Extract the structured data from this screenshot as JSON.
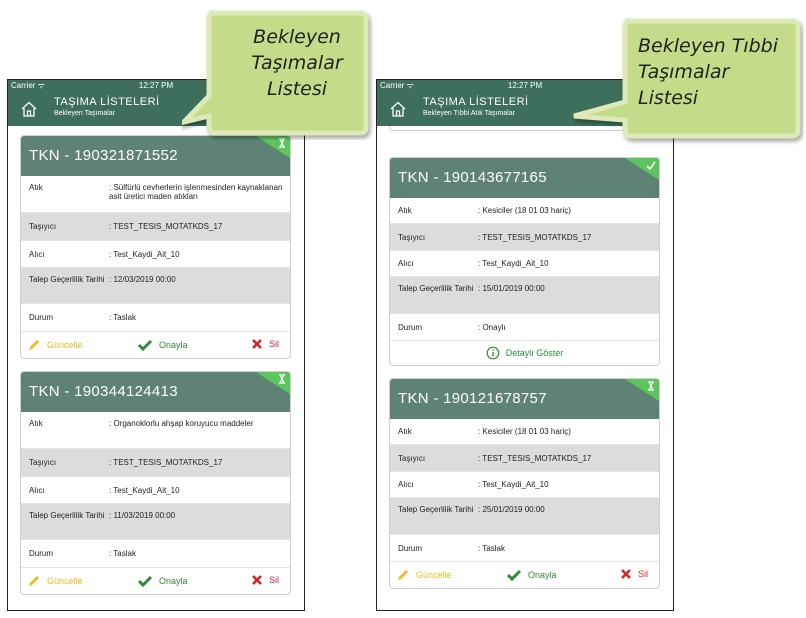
{
  "left_screen": {
    "status": {
      "carrier": "Carrier ᯤ",
      "time": "12:27 PM"
    },
    "header": {
      "title": "TAŞIMA LİSTELERİ",
      "subtitle": "Bekleyen Taşımalar"
    },
    "cards": [
      {
        "tkn": "TKN - 190321871552",
        "rows": [
          {
            "key": "Atık",
            "value": ": Sülfürlü cevherlerin işlenmesinden kaynaklanan asit üretici maden atıkları"
          },
          {
            "key": "Taşıyıcı",
            "value": ": TEST_TESIS_MOTATKDS_17"
          },
          {
            "key": "Alıcı",
            "value": ": Test_Kaydi_Ait_10"
          },
          {
            "key": "Talep Geçerlilik Tarihi",
            "value": ": 12/03/2019  00:00"
          },
          {
            "key": "Durum",
            "value": ": Taslak"
          }
        ],
        "actions": {
          "edit": "Güncelle",
          "approve": "Onayla",
          "delete": "Sil"
        }
      },
      {
        "tkn": "TKN - 190344124413",
        "rows": [
          {
            "key": "Atık",
            "value": ": Organoklorlu ahşap koruyucu maddeler"
          },
          {
            "key": "Taşıyıcı",
            "value": ": TEST_TESIS_MOTATKDS_17"
          },
          {
            "key": "Alıcı",
            "value": ": Test_Kaydi_Ait_10"
          },
          {
            "key": "Talep Geçerlilik Tarihi",
            "value": ": 11/03/2019  00:00"
          },
          {
            "key": "Durum",
            "value": ": Taslak"
          }
        ],
        "actions": {
          "edit": "Güncelle",
          "approve": "Onayla",
          "delete": "Sil"
        }
      }
    ]
  },
  "right_screen": {
    "status": {
      "carrier": "Carrier ᯤ",
      "time": "12:27 PM"
    },
    "header": {
      "title": "TAŞIMA LİSTELERİ",
      "subtitle": "Bekleyen Tıbbi Atık Taşımalar"
    },
    "cards": [
      {
        "tkn": "TKN - 190143677165",
        "rows": [
          {
            "key": "Atık",
            "value": ": Kesiciler (18 01 03 hariç)"
          },
          {
            "key": "Taşıyıcı",
            "value": ": TEST_TESIS_MOTATKDS_17"
          },
          {
            "key": "Alıcı",
            "value": ": Test_Kaydi_Ait_10"
          },
          {
            "key": "Talep Geçerlilik Tarihi",
            "value": ": 15/01/2019  00:00"
          },
          {
            "key": "Durum",
            "value": ": Onaylı"
          }
        ],
        "detail": "Detaylı Göster"
      },
      {
        "tkn": "TKN - 190121678757",
        "rows": [
          {
            "key": "Atık",
            "value": ": Kesiciler (18 01 03 hariç)"
          },
          {
            "key": "Taşıyıcı",
            "value": ": TEST_TESIS_MOTATKDS_17"
          },
          {
            "key": "Alıcı",
            "value": ": Test_Kaydi_Ait_10"
          },
          {
            "key": "Talep Geçerlilik Tarihi",
            "value": ": 25/01/2019  00:00"
          },
          {
            "key": "Durum",
            "value": ": Taslak"
          }
        ],
        "actions": {
          "edit": "Güncelle",
          "approve": "Onayla",
          "delete": "Sil"
        }
      }
    ]
  },
  "callouts": {
    "left": [
      "Bekleyen",
      "Taşımalar",
      "Listesi"
    ],
    "right": [
      "Bekleyen Tıbbi",
      "Taşımalar",
      "Listesi"
    ]
  },
  "colors": {
    "header": "#3e6e5c",
    "card_header": "#5e8374",
    "badge": "#5ec45e",
    "edit": "#f2b81c",
    "approve": "#2e8b3a",
    "delete": "#d9232b",
    "callout": "#c4dc8a"
  }
}
